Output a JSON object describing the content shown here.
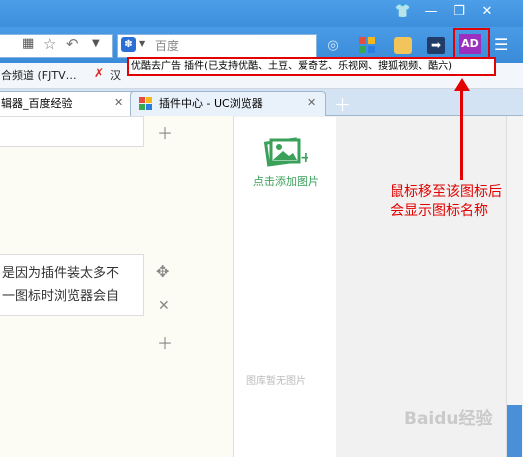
{
  "bookmarks": {
    "item1": "合频道 (FJTV…",
    "item2": "汉"
  },
  "search": {
    "engine_label": "百度"
  },
  "tabs": [
    {
      "label": "辑器_百度经验"
    },
    {
      "label": "插件中心 - UC浏览器"
    }
  ],
  "tooltip": {
    "text": "优酷去广告 插件(已支持优酷、土豆、爱奇艺、乐视网、搜狐视频、酷六)"
  },
  "adblock_icon": {
    "text": "AD"
  },
  "editor": {
    "line1": "是因为插件装太多不",
    "line2": "一图标时浏览器会自"
  },
  "panel": {
    "add_image_label": "点击添加图片",
    "empty_label": "图库暂无图片"
  },
  "annotation": {
    "line1": "鼠标移至该图标后",
    "line2": "会显示图标名称"
  },
  "watermark": {
    "text": "Baidu经验"
  },
  "colors": {
    "accent_blue": "#3d8fdc",
    "annotation_red": "#e20000",
    "adblock_purple": "#9b2fbf",
    "panel_green": "#3aa05a"
  }
}
